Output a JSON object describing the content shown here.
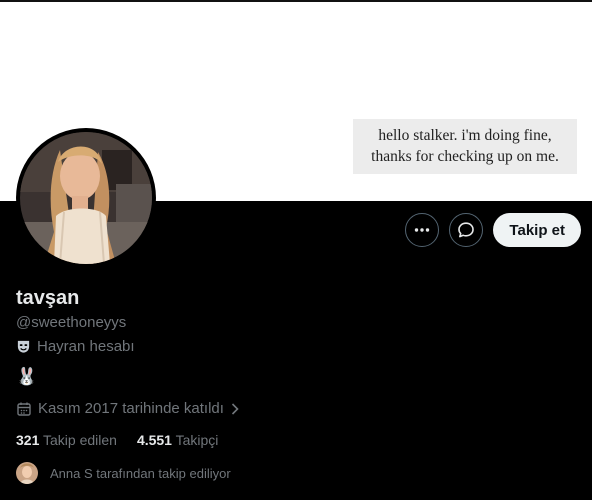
{
  "banner": {
    "note_line1": "hello stalker. i'm doing fine,",
    "note_line2": "thanks for checking up on me."
  },
  "actions": {
    "more_icon": "more-horizontal-icon",
    "message_icon": "message-bubble-icon",
    "follow_label": "Takip et"
  },
  "profile": {
    "name": "tavşan",
    "handle": "@sweethoneyys",
    "category_icon": "theater-mask-icon",
    "category": "Hayran hesabı",
    "bio": "🐰",
    "joined_icon": "calendar-icon",
    "joined": "Kasım 2017 tarihinde katıldı"
  },
  "stats": {
    "following_count": "321",
    "following_label": "Takip edilen",
    "followers_count": "4.551",
    "followers_label": "Takipçi"
  },
  "followed_by": {
    "text": "Anna S tarafından takip ediliyor"
  },
  "colors": {
    "background": "#000000",
    "banner": "#ffffff",
    "muted_text": "#71767b",
    "primary_text": "#e7e9ea",
    "button_bg": "#eff3f4"
  }
}
